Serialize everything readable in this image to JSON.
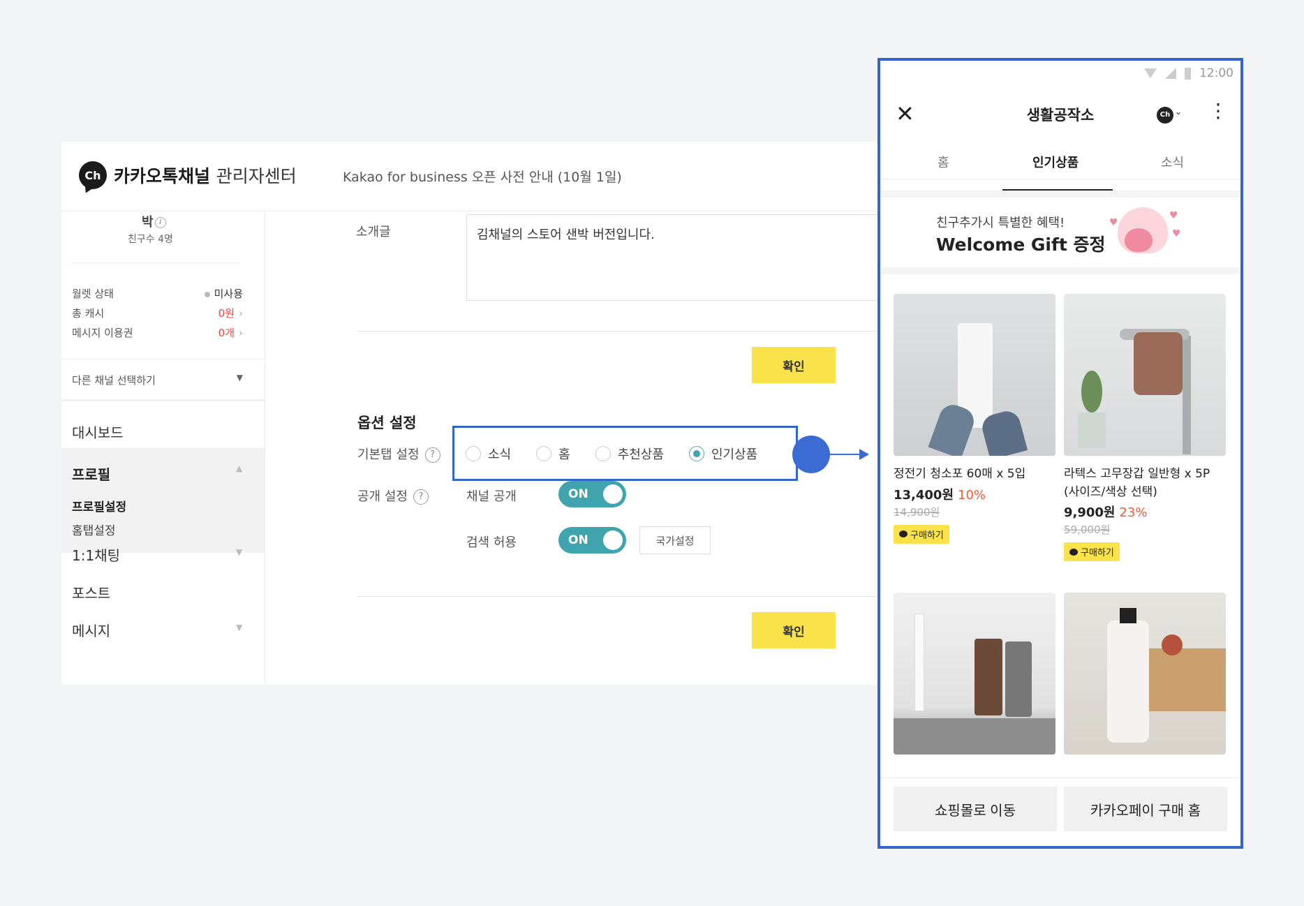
{
  "admin": {
    "logo_text": "Ch",
    "brand_bold": "카카오톡채널",
    "brand_light": "관리자센터",
    "notice": "Kakao for business 오픈 사전 안내 (10월 1일)"
  },
  "sidebar": {
    "channel_name": "박",
    "friends": "친구수 4명",
    "wallet_label": "월렛 상태",
    "wallet_value": "미사용",
    "cash_label": "총 캐시",
    "cash_value": "0원",
    "ticket_label": "메시지 이용권",
    "ticket_value": "0개",
    "select_channel": "다른 채널 선택하기",
    "menu": {
      "dashboard": "대시보드",
      "profile": "프로필",
      "profile_settings": "프로필설정",
      "home_tab_settings": "홈탭설정",
      "chat": "1:1채팅",
      "post": "포스트",
      "message": "메시지"
    }
  },
  "form": {
    "intro_label": "소개글",
    "intro_value": "김채널의 스토어 샌박 버전입니다.",
    "confirm": "확인",
    "options_title": "옵션 설정",
    "default_tab_label": "기본탭 설정",
    "radio_options": [
      "소식",
      "홈",
      "추천상품",
      "인기상품"
    ],
    "selected_option": "인기상품",
    "visibility_label": "공개 설정",
    "channel_public_label": "채널 공개",
    "search_allow_label": "검색 허용",
    "toggle_on": "ON",
    "country_button": "국가설정",
    "help_glyph": "?"
  },
  "phone": {
    "time": "12:00",
    "title": "생활공작소",
    "ch_badge": "Ch",
    "tabs": [
      "홈",
      "인기상품",
      "소식"
    ],
    "active_tab": "인기상품",
    "banner_line1": "친구추가시 특별한 혜택!",
    "banner_line2": "Welcome Gift 증정",
    "products": [
      {
        "name": "정전기 청소포 60매 x 5입",
        "price": "13,400원",
        "discount": "10%",
        "original": "14,900원",
        "buy": "구매하기"
      },
      {
        "name": "라텍스 고무장갑 일반형 x 5P (사이즈/색상 선택)",
        "price": "9,900원",
        "discount": "23%",
        "original": "59,000원",
        "buy": "구매하기"
      }
    ],
    "footer_left": "쇼핑몰로 이동",
    "footer_right": "카카오페이 구매 홈"
  },
  "colors": {
    "accent_yellow": "#fae34a",
    "toggle_teal": "#3fa4ae",
    "highlight_blue": "#3366cc",
    "discount_red": "#f05a3a"
  }
}
